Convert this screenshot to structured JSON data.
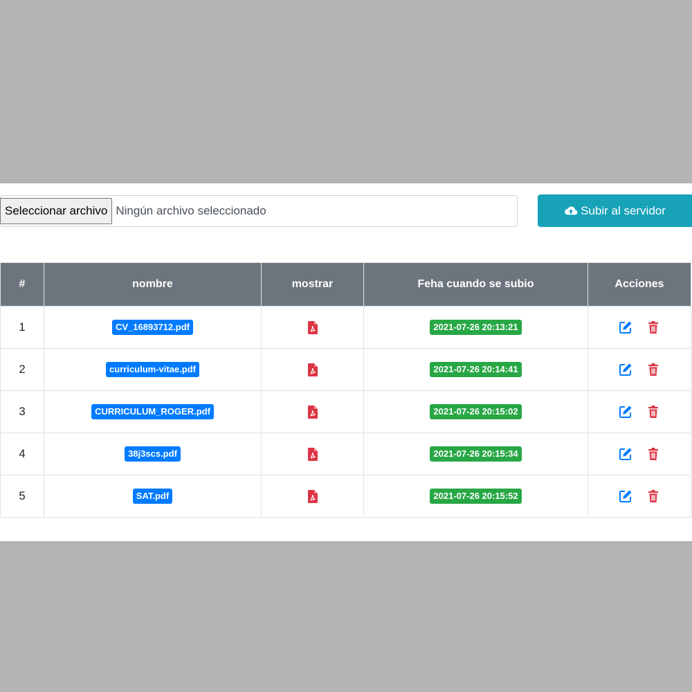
{
  "upload": {
    "file_button_label": "Seleccionar archivo",
    "file_status": "Ningún archivo seleccionado",
    "submit_label": "Subir al servidor"
  },
  "table": {
    "headers": [
      "#",
      "nombre",
      "mostrar",
      "Feha cuando se subio",
      "Acciones"
    ],
    "rows": [
      {
        "num": "1",
        "name": "CV_16893712.pdf",
        "date": "2021-07-26 20:13:21"
      },
      {
        "num": "2",
        "name": "curriculum-vitae.pdf",
        "date": "2021-07-26 20:14:41"
      },
      {
        "num": "3",
        "name": "CURRICULUM_ROGER.pdf",
        "date": "2021-07-26 20:15:02"
      },
      {
        "num": "4",
        "name": "38j3scs.pdf",
        "date": "2021-07-26 20:15:34"
      },
      {
        "num": "5",
        "name": "SAT.pdf",
        "date": "2021-07-26 20:15:52"
      }
    ]
  },
  "icons": {
    "upload": "cloud-upload-icon",
    "show": "file-pdf-icon",
    "edit": "edit-icon",
    "delete": "trash-icon"
  },
  "colors": {
    "header_bg": "#6c757d",
    "primary": "#007bff",
    "success": "#28a745",
    "info": "#17a2b8",
    "danger": "#dc3545"
  }
}
